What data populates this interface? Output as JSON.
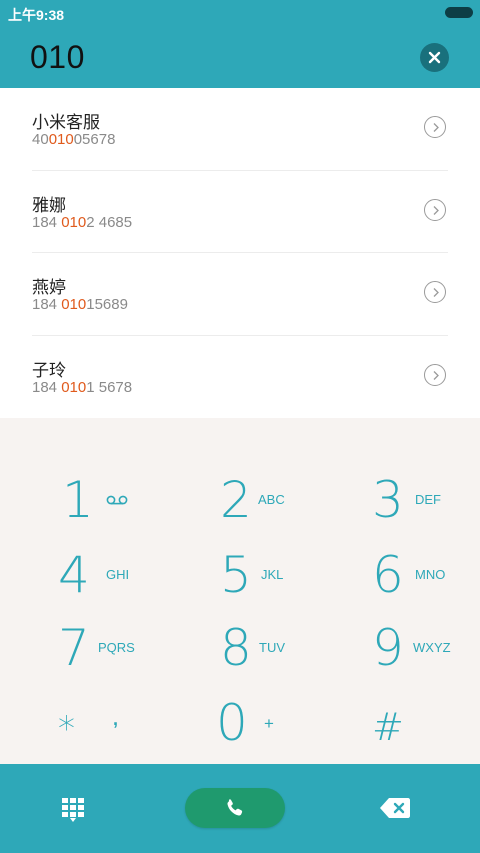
{
  "status_bar": {
    "time": "上午9:38"
  },
  "dialer": {
    "input_value": "010"
  },
  "contacts": [
    {
      "name": "小米客服",
      "phone_pre": "40",
      "phone_match": "010",
      "phone_post": "05678"
    },
    {
      "name": "雅娜",
      "phone_pre": "184 ",
      "phone_match": "010",
      "phone_post": "2 4685"
    },
    {
      "name": "燕婷",
      "phone_pre": "184 ",
      "phone_match": "010",
      "phone_post": "15689"
    },
    {
      "name": "子玲",
      "phone_pre": "184 ",
      "phone_match": "010",
      "phone_post": "1 5678"
    }
  ],
  "keypad": {
    "keys": [
      {
        "digit": "1",
        "letters": ""
      },
      {
        "digit": "2",
        "letters": "ABC"
      },
      {
        "digit": "3",
        "letters": "DEF"
      },
      {
        "digit": "4",
        "letters": "GHI"
      },
      {
        "digit": "5",
        "letters": "JKL"
      },
      {
        "digit": "6",
        "letters": "MNO"
      },
      {
        "digit": "7",
        "letters": "PQRS"
      },
      {
        "digit": "8",
        "letters": "TUV"
      },
      {
        "digit": "9",
        "letters": "WXYZ"
      },
      {
        "digit": "*",
        "letters": ","
      },
      {
        "digit": "0",
        "letters": "+"
      },
      {
        "digit": "#",
        "letters": ""
      }
    ]
  },
  "icons": {
    "voicemail": "voicemail-icon",
    "clear": "clear-icon",
    "chevron": "chevron-right-icon",
    "dialpad": "dialpad-icon",
    "call": "phone-icon",
    "backspace": "backspace-icon"
  },
  "colors": {
    "accent": "#2ea8b8",
    "highlight": "#e05a1c",
    "call_button": "#1f9a6e",
    "keypad_background": "#f7f3f1"
  }
}
